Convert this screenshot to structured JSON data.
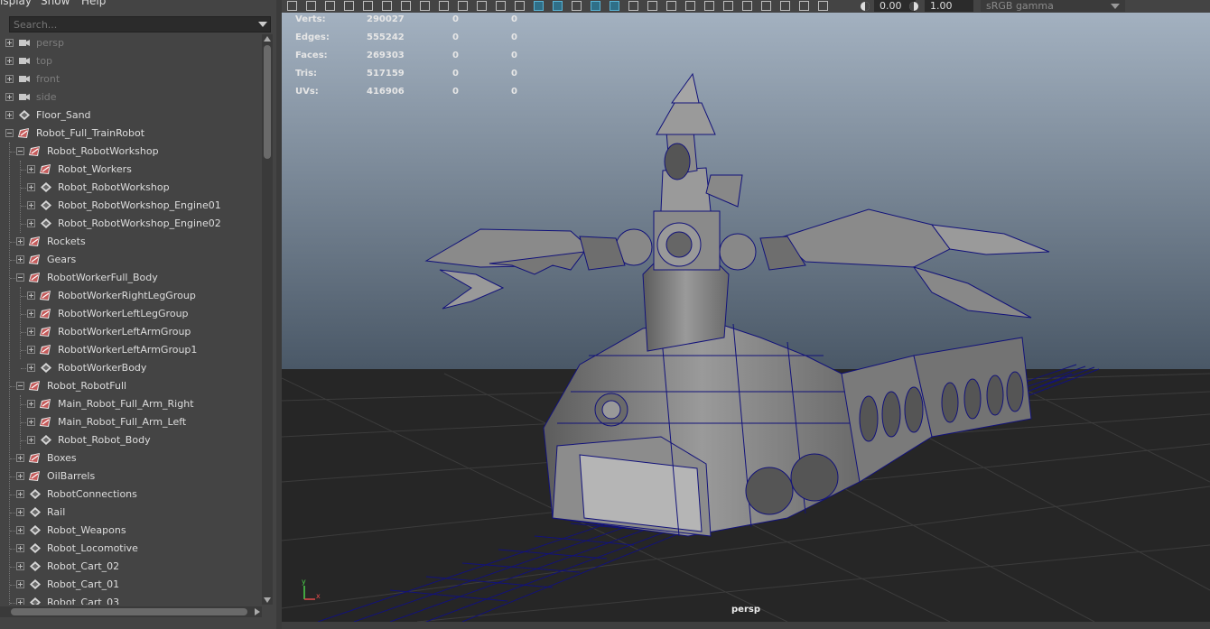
{
  "menu": {
    "display": "isplay",
    "show": "Show",
    "help": "Help"
  },
  "search": {
    "placeholder": "Search..."
  },
  "outliner": {
    "items": [
      {
        "label": "persp",
        "icon": "camera-icon",
        "depth": 0,
        "expanded": false,
        "camera": true
      },
      {
        "label": "top",
        "icon": "camera-icon",
        "depth": 0,
        "expanded": false,
        "camera": true
      },
      {
        "label": "front",
        "icon": "camera-icon",
        "depth": 0,
        "expanded": false,
        "camera": true
      },
      {
        "label": "side",
        "icon": "camera-icon",
        "depth": 0,
        "expanded": false,
        "camera": true
      },
      {
        "label": "Floor_Sand",
        "icon": "transform-icon",
        "depth": 0,
        "expanded": false
      },
      {
        "label": "Robot_Full_TrainRobot",
        "icon": "group-icon",
        "depth": 0,
        "expanded": true
      },
      {
        "label": "Robot_RobotWorkshop",
        "icon": "group-icon",
        "depth": 1,
        "expanded": true
      },
      {
        "label": "Robot_Workers",
        "icon": "group-icon",
        "depth": 2,
        "expanded": false
      },
      {
        "label": "Robot_RobotWorkshop",
        "icon": "transform-icon",
        "depth": 2,
        "expanded": false
      },
      {
        "label": "Robot_RobotWorkshop_Engine01",
        "icon": "transform-icon",
        "depth": 2,
        "expanded": false
      },
      {
        "label": "Robot_RobotWorkshop_Engine02",
        "icon": "transform-icon",
        "depth": 2,
        "expanded": false
      },
      {
        "label": "Rockets",
        "icon": "group-icon",
        "depth": 1,
        "expanded": false
      },
      {
        "label": "Gears",
        "icon": "group-icon",
        "depth": 1,
        "expanded": false
      },
      {
        "label": "RobotWorkerFull_Body",
        "icon": "group-icon",
        "depth": 1,
        "expanded": true
      },
      {
        "label": "RobotWorkerRightLegGroup",
        "icon": "group-icon",
        "depth": 2,
        "expanded": false
      },
      {
        "label": "RobotWorkerLeftLegGroup",
        "icon": "group-icon",
        "depth": 2,
        "expanded": false
      },
      {
        "label": "RobotWorkerLeftArmGroup",
        "icon": "group-icon",
        "depth": 2,
        "expanded": false
      },
      {
        "label": "RobotWorkerLeftArmGroup1",
        "icon": "group-icon",
        "depth": 2,
        "expanded": false
      },
      {
        "label": "RobotWorkerBody",
        "icon": "transform-icon",
        "depth": 2,
        "expanded": false
      },
      {
        "label": "Robot_RobotFull",
        "icon": "group-icon",
        "depth": 1,
        "expanded": true
      },
      {
        "label": "Main_Robot_Full_Arm_Right",
        "icon": "group-icon",
        "depth": 2,
        "expanded": false
      },
      {
        "label": "Main_Robot_Full_Arm_Left",
        "icon": "group-icon",
        "depth": 2,
        "expanded": false
      },
      {
        "label": "Robot_Robot_Body",
        "icon": "transform-icon",
        "depth": 2,
        "expanded": false
      },
      {
        "label": "Boxes",
        "icon": "group-icon",
        "depth": 1,
        "expanded": false
      },
      {
        "label": "OilBarrels",
        "icon": "group-icon",
        "depth": 1,
        "expanded": false
      },
      {
        "label": "RobotConnections",
        "icon": "transform-icon",
        "depth": 1,
        "expanded": false
      },
      {
        "label": "Rail",
        "icon": "transform-icon",
        "depth": 1,
        "expanded": false
      },
      {
        "label": "Robot_Weapons",
        "icon": "transform-icon",
        "depth": 1,
        "expanded": false
      },
      {
        "label": "Robot_Locomotive",
        "icon": "transform-icon",
        "depth": 1,
        "expanded": false
      },
      {
        "label": "Robot_Cart_02",
        "icon": "transform-icon",
        "depth": 1,
        "expanded": false
      },
      {
        "label": "Robot_Cart_01",
        "icon": "transform-icon",
        "depth": 1,
        "expanded": false
      },
      {
        "label": "Robot_Cart_03",
        "icon": "transform-icon",
        "depth": 1,
        "expanded": false
      }
    ]
  },
  "toolbar": {
    "exposure": "0.00",
    "gamma_value": "1.00",
    "color_space": "sRGB gamma"
  },
  "hud": {
    "rows": [
      {
        "label": "Verts:",
        "total": "290027",
        "selected": "0",
        "components": "0"
      },
      {
        "label": "Edges:",
        "total": "555242",
        "selected": "0",
        "components": "0"
      },
      {
        "label": "Faces:",
        "total": "269303",
        "selected": "0",
        "components": "0"
      },
      {
        "label": "Tris:",
        "total": "517159",
        "selected": "0",
        "components": "0"
      },
      {
        "label": "UVs:",
        "total": "416906",
        "selected": "0",
        "components": "0"
      }
    ]
  },
  "viewport": {
    "camera": "persp",
    "axis_x": "x",
    "axis_y": "y"
  },
  "colors": {
    "panel": "#444444",
    "wire": "#12127a",
    "mesh": "#8a8a8a",
    "sky_top": "#a3b1c0",
    "sky_bottom": "#4a5867",
    "floor": "#262626",
    "group_icon": "#c55a5a"
  }
}
